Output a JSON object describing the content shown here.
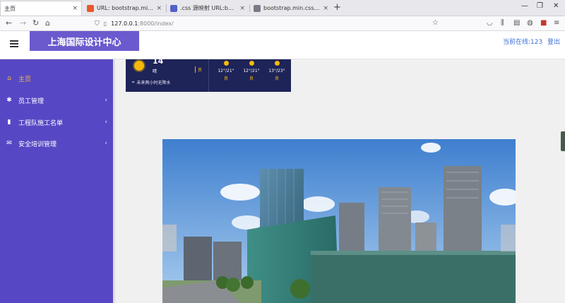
{
  "browser": {
    "tabs": [
      {
        "label": "主页",
        "close": "×",
        "active": true
      },
      {
        "label": "URL: bootstrap.min.css.map",
        "close": "×",
        "active": false
      },
      {
        "label": ".css 源映射 URL:bootstrap.css",
        "close": "×",
        "active": false
      },
      {
        "label": "bootstrap.min.css.map - 面码",
        "close": "×",
        "active": false
      }
    ],
    "new_tab": "+",
    "window_controls": {
      "minimize": "—",
      "restore": "❐",
      "close": "✕"
    },
    "url_host": "127.0.0.1",
    "url_rest": ":8000/index/",
    "nav": {
      "back": "←",
      "forward": "→",
      "reload": "↻",
      "home": "⌂"
    }
  },
  "header": {
    "menu_icon": "hamburger-icon",
    "brand": "上海国际设计中心",
    "online_label": "当前在线:123",
    "logout_label": "登出"
  },
  "sidebar": {
    "items": [
      {
        "icon": "home-icon",
        "glyph": "⌂",
        "label": "主页",
        "chevron": "",
        "active": true
      },
      {
        "icon": "gears-icon",
        "glyph": "✱",
        "label": "员工管理",
        "chevron": "‹",
        "active": false
      },
      {
        "icon": "book-icon",
        "glyph": "▮",
        "label": "工程队施工名单",
        "chevron": "‹",
        "active": false
      },
      {
        "icon": "envelope-icon",
        "glyph": "✉",
        "label": "安全培训管理",
        "chevron": "‹",
        "active": false
      }
    ]
  },
  "weather": {
    "temp": "14",
    "condition": "晴",
    "aqi": "良",
    "forecast_note": "未来两小时无降水",
    "days": [
      {
        "range": "12°/21°",
        "quality": "良"
      },
      {
        "range": "12°/21°",
        "quality": "良"
      },
      {
        "range": "13°/23°",
        "quality": "良"
      }
    ]
  },
  "colors": {
    "sidebar_bg": "#5648c4",
    "brand_bg": "#6a5acd",
    "active_item": "#ffb833",
    "link": "#3a6fd8",
    "weather_bg": "#1e2358"
  }
}
